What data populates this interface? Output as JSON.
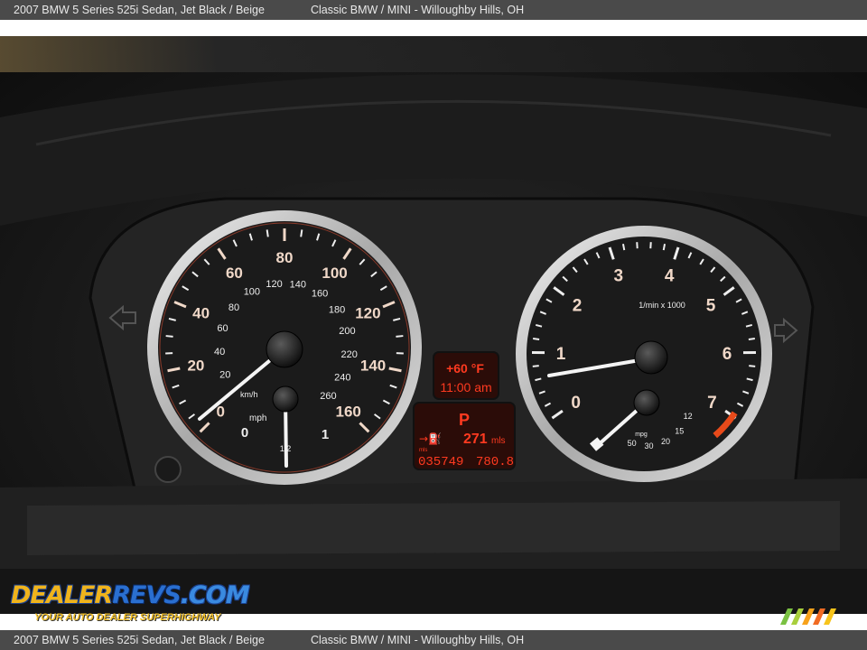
{
  "caption": {
    "vehicle": "2007 BMW 5 Series 525i Sedan,   Jet Black / Beige",
    "dealer": "Classic BMW / MINI - Willoughby Hills, OH"
  },
  "speedometer": {
    "mph_labels": [
      "0",
      "20",
      "40",
      "60",
      "80",
      "100",
      "120",
      "140",
      "160"
    ],
    "kmh_labels": [
      "20",
      "40",
      "60",
      "80",
      "100",
      "120",
      "140",
      "160",
      "180",
      "200",
      "220",
      "240",
      "260"
    ],
    "unit_kmh": "km/h",
    "unit_mph": "mph",
    "fuel_labels": [
      "0",
      "1/2",
      "1"
    ]
  },
  "tachometer": {
    "labels": [
      "0",
      "1",
      "2",
      "3",
      "4",
      "5",
      "6",
      "7"
    ],
    "unit": "1/min x 1000",
    "economy_labels": [
      "50",
      "30",
      "20",
      "15",
      "12"
    ],
    "economy_unit": "mpg",
    "redline_color": "#e84a1a"
  },
  "display": {
    "temperature": "+60 °F",
    "clock": "11:00 am",
    "gear": "P",
    "range": "271",
    "range_unit": "mls",
    "odometer": "035749",
    "trip": "780.8",
    "odometer_unit": "mls"
  },
  "watermark": {
    "brand_part1": "DEALER",
    "brand_part2": "REVS",
    "brand_part3": ".COM",
    "tagline": "YOUR AUTO DEALER SUPERHIGHWAY"
  }
}
